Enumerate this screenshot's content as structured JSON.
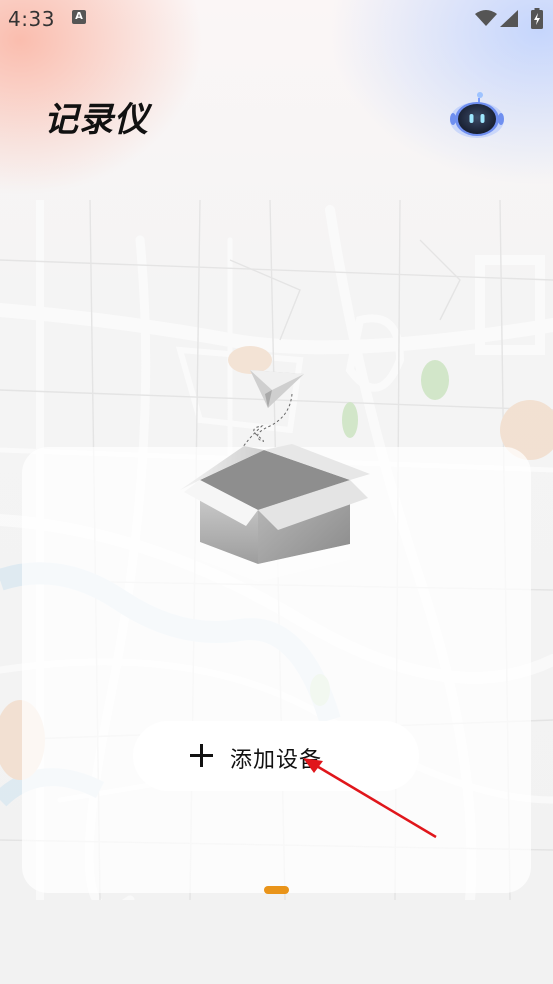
{
  "status_bar": {
    "time": "4:33",
    "notification_icon": "A",
    "icons": [
      "wifi-icon",
      "cell-signal-icon",
      "battery-charging-icon"
    ]
  },
  "header": {
    "title": "记录仪",
    "assistant_icon": "robot-assistant-icon"
  },
  "empty_state": {
    "illustration": "open-box-paper-plane-icon",
    "add_button_icon": "plus-icon",
    "add_button_label": "添加设备"
  },
  "pager": {
    "pages": 1,
    "active_index": 0,
    "active_color": "#e9941a"
  },
  "colors": {
    "accent": "#e9941a",
    "annotation_arrow": "#e0161b"
  }
}
